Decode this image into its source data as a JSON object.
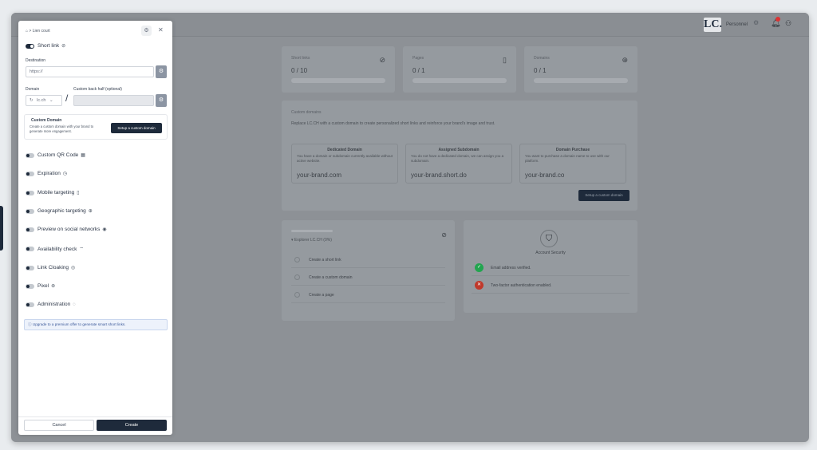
{
  "topbar": {
    "logo": "LC.",
    "workspace": "Personnel"
  },
  "stats": [
    {
      "label": "Short links",
      "value": "0 / 10",
      "icon": "link-icon"
    },
    {
      "label": "Pages",
      "value": "0 / 1",
      "icon": "page-icon"
    },
    {
      "label": "Domains",
      "value": "0 / 1",
      "icon": "globe-icon"
    }
  ],
  "custom_domains": {
    "title": "Custom domains",
    "subtitle": "Replace LC.CH with a custom domain to create personalized short links and reinforce your brand's image and trust.",
    "boxes": [
      {
        "title": "Dedicated Domain",
        "text": "You have a domain or subdomain currently available without active website.",
        "url": "your-brand.com"
      },
      {
        "title": "Assigned Subdomain",
        "text": "You do not have a dedicated domain, we can assign you a subdomain.",
        "url": "your-brand.short.do"
      },
      {
        "title": "Domain Purchase",
        "text": "You want to purchase a domain name to use with our platform.",
        "url": "your-brand.co"
      }
    ],
    "button": "Setup a custom domain"
  },
  "onboarding": {
    "title": "▾ Explorer LC.CH (0%)",
    "items": [
      "Create a short link",
      "Create a custom domain",
      "Create a page"
    ]
  },
  "security": {
    "title": "Account Security",
    "items": [
      {
        "text": "Email address verified.",
        "status": "ok",
        "color": "#22c55e"
      },
      {
        "text": "Two-factor authentication enabled.",
        "status": "no",
        "color": "#ef4444"
      }
    ]
  },
  "panel": {
    "breadcrumb": "⌂ > Lien court",
    "short_link_label": "Short link",
    "destination_label": "Destination",
    "destination_placeholder": "https://",
    "domain_label": "Domain",
    "domain_value": "lc.ch",
    "backhalf_label": "Custom back half (optional)",
    "custom_domain": {
      "title": "Custom Domain",
      "text": "Create a custom domain with your brand to generate more engagement.",
      "button": "Setup a custom domain"
    },
    "options": [
      {
        "label": "Custom QR Code",
        "icon": "▦"
      },
      {
        "label": "Expiration",
        "icon": "◷"
      },
      {
        "label": "Mobile targeting",
        "icon": "▯"
      },
      {
        "label": "Geographic targeting",
        "icon": "⊕"
      },
      {
        "label": "Preview on social networks",
        "icon": "◉"
      },
      {
        "label": "Availability check",
        "icon": "⌔"
      },
      {
        "label": "Link Cloaking",
        "icon": "◎"
      },
      {
        "label": "Pixel",
        "icon": "⊛"
      },
      {
        "label": "Administration",
        "icon": "◌"
      }
    ],
    "upgrade_text": "ⓘ Upgrade to a premium offer to generate smart short links.",
    "cancel": "Cancel",
    "create": "Create"
  }
}
